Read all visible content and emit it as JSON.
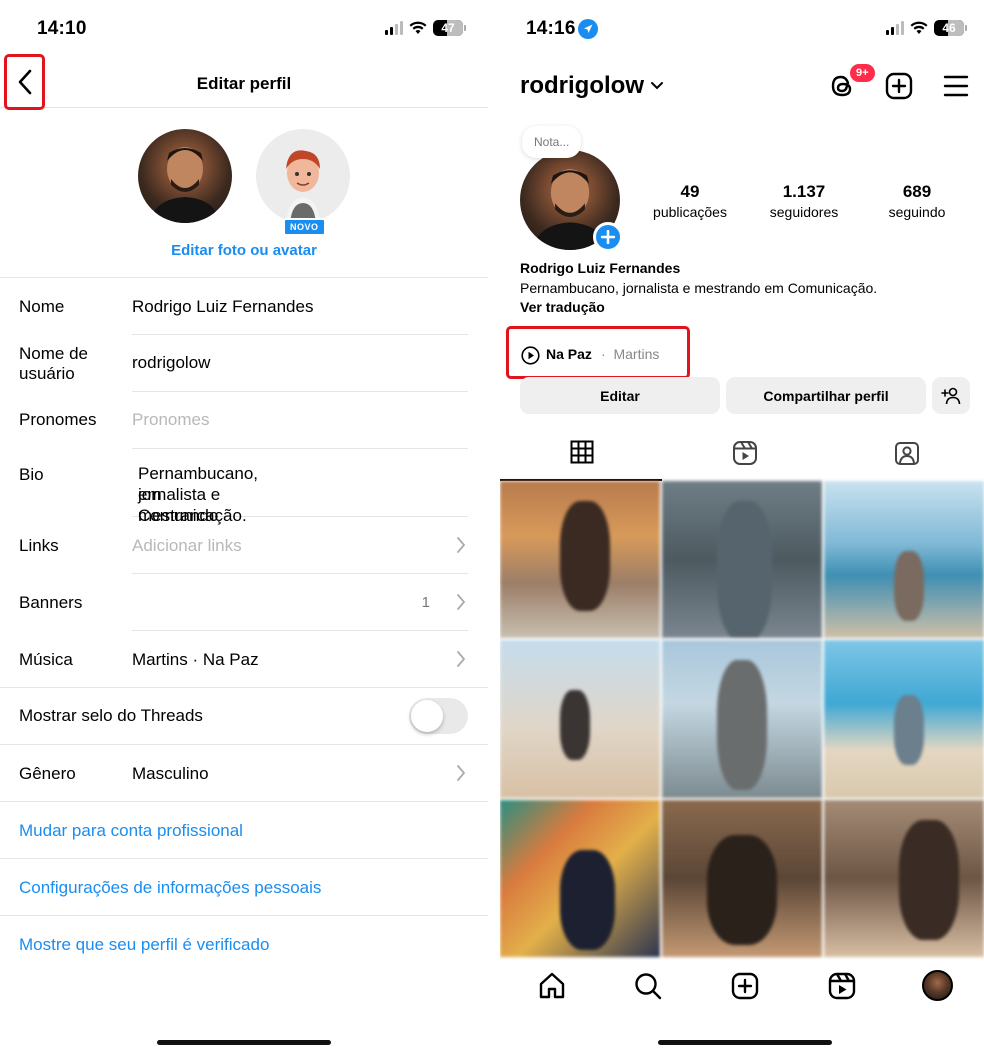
{
  "left": {
    "status": {
      "time": "14:10",
      "battery": "47",
      "battery_level": 0.47
    },
    "title": "Editar perfil",
    "edit_photo": "Editar foto ou avatar",
    "novo_badge": "NOVO",
    "fields": {
      "nome": {
        "label": "Nome",
        "value": "Rodrigo Luiz Fernandes"
      },
      "usuario": {
        "label_l1": "Nome de",
        "label_l2": "usuário",
        "value": "rodrigolow"
      },
      "pronomes": {
        "label": "Pronomes",
        "placeholder": "Pronomes"
      },
      "bio": {
        "label": "Bio",
        "value_l1": "Pernambucano, jornalista e mestrando",
        "value_l2": "em Comunicação."
      },
      "links": {
        "label": "Links",
        "placeholder": "Adicionar links"
      },
      "banners": {
        "label": "Banners",
        "count": "1"
      },
      "musica": {
        "label": "Música",
        "value": "Martins · Na Paz"
      }
    },
    "threads_toggle": {
      "label": "Mostrar selo do Threads",
      "on": false
    },
    "genero": {
      "label": "Gênero",
      "value": "Masculino"
    },
    "links_rows": {
      "profissional": "Mudar para conta profissional",
      "info_pessoais": "Configurações de informações pessoais",
      "verificado": "Mostre que seu perfil é verificado"
    }
  },
  "right": {
    "status": {
      "time": "14:16",
      "battery": "46",
      "battery_level": 0.46
    },
    "username": "rodrigolow",
    "threads_badge": "9+",
    "nota": "Nota...",
    "stats": [
      {
        "num": "49",
        "label": "publicações"
      },
      {
        "num": "1.137",
        "label": "seguidores"
      },
      {
        "num": "689",
        "label": "seguindo"
      }
    ],
    "full_name": "Rodrigo Luiz Fernandes",
    "bio": "Pernambucano, jornalista e mestrando em Comunicação.",
    "translate": "Ver tradução",
    "music": {
      "song": "Na Paz",
      "separator": "·",
      "artist": "Martins"
    },
    "buttons": {
      "edit": "Editar",
      "share": "Compartilhar perfil"
    }
  },
  "icons": [
    "chevron-left-icon",
    "chevron-right-icon",
    "threads-icon",
    "plus-square-icon",
    "menu-icon",
    "grid-icon",
    "reels-icon",
    "tagged-icon",
    "home-icon",
    "search-icon",
    "create-icon",
    "person-add-icon",
    "play-icon",
    "wifi-icon",
    "location-arrow-icon",
    "chevron-down-icon"
  ],
  "colors": {
    "accent": "#1a8df0",
    "highlight_box": "#e1141e",
    "badge": "#ff2d4a"
  }
}
